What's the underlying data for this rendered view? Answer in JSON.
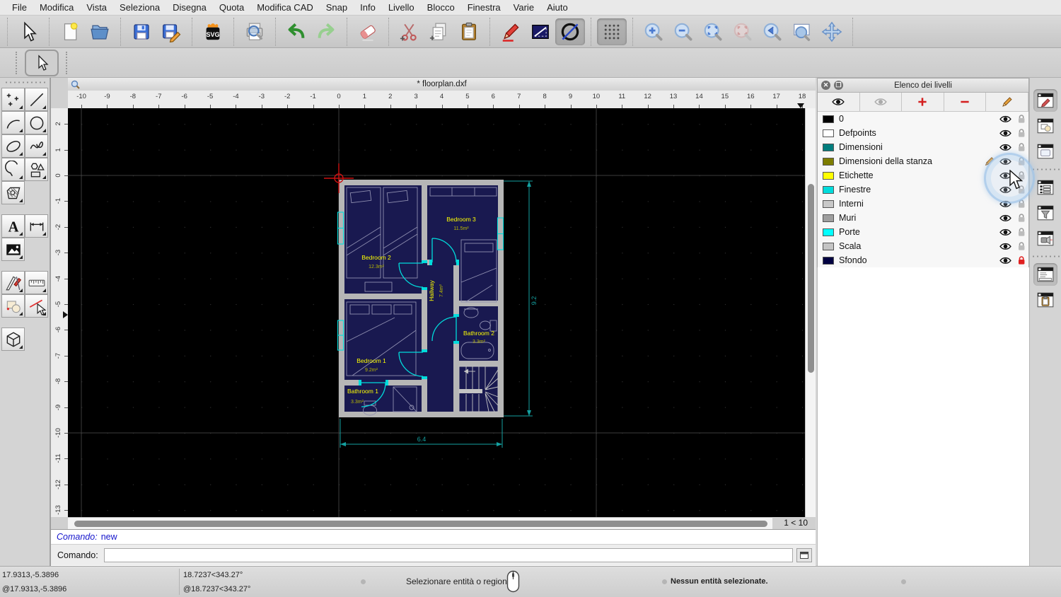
{
  "app": {
    "document_title": "* floorplan.dxf",
    "zoom_indicator": "1 < 10"
  },
  "colors": {
    "canvas_bg": "#000000",
    "room_fill": "#191950",
    "wall": "#b6b6b6",
    "door_window": "#00dcdc",
    "dimension": "#14a0a0",
    "label": "#ffff00",
    "label_area": "#b9b900",
    "furniture": "#8f8fb0",
    "grid_dot": "#2e2e2e",
    "metagrid": "#3c3c3c",
    "crosshair": "#cc1111"
  },
  "menu": {
    "items": [
      "File",
      "Modifica",
      "Vista",
      "Seleziona",
      "Disegna",
      "Quota",
      "Modifica CAD",
      "Snap",
      "Info",
      "Livello",
      "Blocco",
      "Finestra",
      "Varie",
      "Aiuto"
    ]
  },
  "toolbar": {
    "groups": [
      [
        {
          "name": "selection-pointer",
          "icon": "cursor"
        }
      ],
      [
        {
          "name": "new-document",
          "icon": "new-file"
        },
        {
          "name": "open-document",
          "icon": "open-folder"
        }
      ],
      [
        {
          "name": "save-document",
          "icon": "save"
        },
        {
          "name": "save-as",
          "icon": "save-as"
        }
      ],
      [
        {
          "name": "svg-export",
          "icon": "svg"
        }
      ],
      [
        {
          "name": "print-preview",
          "icon": "print-preview"
        }
      ],
      [
        {
          "name": "undo",
          "icon": "undo"
        },
        {
          "name": "redo",
          "icon": "redo"
        }
      ],
      [
        {
          "name": "delete-entities",
          "icon": "eraser"
        }
      ],
      [
        {
          "name": "cut",
          "icon": "cut"
        },
        {
          "name": "copy",
          "icon": "copy"
        },
        {
          "name": "paste",
          "icon": "paste"
        }
      ],
      [
        {
          "name": "draw-sketch",
          "icon": "pencil-red"
        },
        {
          "name": "bounding-box",
          "icon": "line-box"
        },
        {
          "name": "construction-mode",
          "icon": "circle-slash",
          "active": true
        }
      ],
      [
        {
          "name": "grid-toggle",
          "icon": "grid",
          "active": true
        }
      ],
      [
        {
          "name": "zoom-in",
          "icon": "zoom-in"
        },
        {
          "name": "zoom-out",
          "icon": "zoom-out"
        },
        {
          "name": "zoom-auto",
          "icon": "zoom-auto"
        },
        {
          "name": "zoom-selection",
          "icon": "zoom-selection",
          "disabled": true
        },
        {
          "name": "zoom-previous",
          "icon": "zoom-previous"
        },
        {
          "name": "zoom-window",
          "icon": "zoom-window"
        },
        {
          "name": "zoom-pan",
          "icon": "zoom-pan"
        }
      ]
    ]
  },
  "options_toolbar": {
    "buttons": [
      {
        "name": "selection-pointer-tool",
        "icon": "cursor",
        "active": true
      }
    ]
  },
  "palette": {
    "rows": [
      {
        "items": [
          "add-points",
          "draw-line"
        ]
      },
      {
        "items": [
          "draw-arc",
          "draw-circle"
        ]
      },
      {
        "items": [
          "draw-ellipse",
          "draw-spline"
        ]
      },
      {
        "items": [
          "draw-polyline",
          "draw-shapes"
        ]
      },
      {
        "items": [
          "draw-hatch",
          null
        ]
      },
      {
        "items": [
          "draw-text",
          "draw-dimension"
        ],
        "gap": true
      },
      {
        "items": [
          "insert-image",
          null
        ]
      },
      {
        "items": [
          "modify-tools",
          "measure-tools"
        ],
        "gap": true
      },
      {
        "items": [
          "block-tools",
          "select-entity"
        ]
      },
      {
        "items": [
          "view-3d",
          null
        ],
        "gap": true
      }
    ]
  },
  "rulers": {
    "horizontal": [
      -10,
      -9,
      -8,
      -7,
      -6,
      -5,
      -4,
      -3,
      -2,
      -1,
      0,
      1,
      2,
      3,
      4,
      5,
      6,
      7,
      8,
      9,
      10,
      11,
      12,
      13,
      14,
      15,
      16,
      17,
      18
    ],
    "vertical": [
      2,
      1,
      0,
      -1,
      -2,
      -3,
      -4,
      -5,
      -6,
      -7,
      -8,
      -9,
      -10,
      -11,
      -12,
      -13
    ]
  },
  "floorplan": {
    "rooms": [
      {
        "name": "Bedroom 3",
        "area": "11.5m²"
      },
      {
        "name": "Bedroom 2",
        "area": "12.3m²"
      },
      {
        "name": "Hallway",
        "area": "7.4m²"
      },
      {
        "name": "Bedroom 1",
        "area": "9.2m²"
      },
      {
        "name": "Bathroom 2",
        "area": "3.3m²"
      },
      {
        "name": "Bathroom 1",
        "area": "3.3m²"
      }
    ],
    "dimensions": {
      "width": "6.4",
      "height": "9.2"
    }
  },
  "layers_panel": {
    "title": "Elenco dei livelli",
    "toolbar": [
      "show-all-layers",
      "hide-all-layers",
      "add-layer",
      "remove-layer",
      "edit-layer"
    ],
    "layers": [
      {
        "name": "0",
        "color": "#000000"
      },
      {
        "name": "Defpoints",
        "color": "#ffffff"
      },
      {
        "name": "Dimensioni",
        "color": "#007d7d"
      },
      {
        "name": "Dimensioni della stanza",
        "color": "#7d7d00",
        "current": true
      },
      {
        "name": "Etichette",
        "color": "#ffff00"
      },
      {
        "name": "Finestre",
        "color": "#00dcdc"
      },
      {
        "name": "Interni",
        "color": "#c8c8c8"
      },
      {
        "name": "Muri",
        "color": "#9e9e9e"
      },
      {
        "name": "Porte",
        "color": "#00ffff"
      },
      {
        "name": "Scala",
        "color": "#c4c4c4"
      },
      {
        "name": "Sfondo",
        "color": "#000040",
        "locked": true
      }
    ]
  },
  "dock": {
    "items": [
      {
        "name": "property-editor",
        "active": true
      },
      {
        "name": "block-browser"
      },
      {
        "name": "library-browser"
      },
      {
        "sep": true
      },
      {
        "name": "view-list"
      },
      {
        "name": "selection-filter"
      },
      {
        "name": "light-view"
      },
      {
        "sep": true
      },
      {
        "name": "command-history",
        "active": true
      },
      {
        "name": "clipboard-viewer"
      }
    ]
  },
  "command": {
    "history_label": "Comando:",
    "history_value": "new",
    "prompt_label": "Comando:",
    "input_value": ""
  },
  "statusbar": {
    "absolute": "17.9313,-5.3896",
    "relative": "@17.9313,-5.3896",
    "polar": "18.7237<343.27°",
    "relative_polar": "@18.7237<343.27°",
    "hint": "Selezionare entità o regione",
    "selection": "Nessun entità selezionate."
  }
}
